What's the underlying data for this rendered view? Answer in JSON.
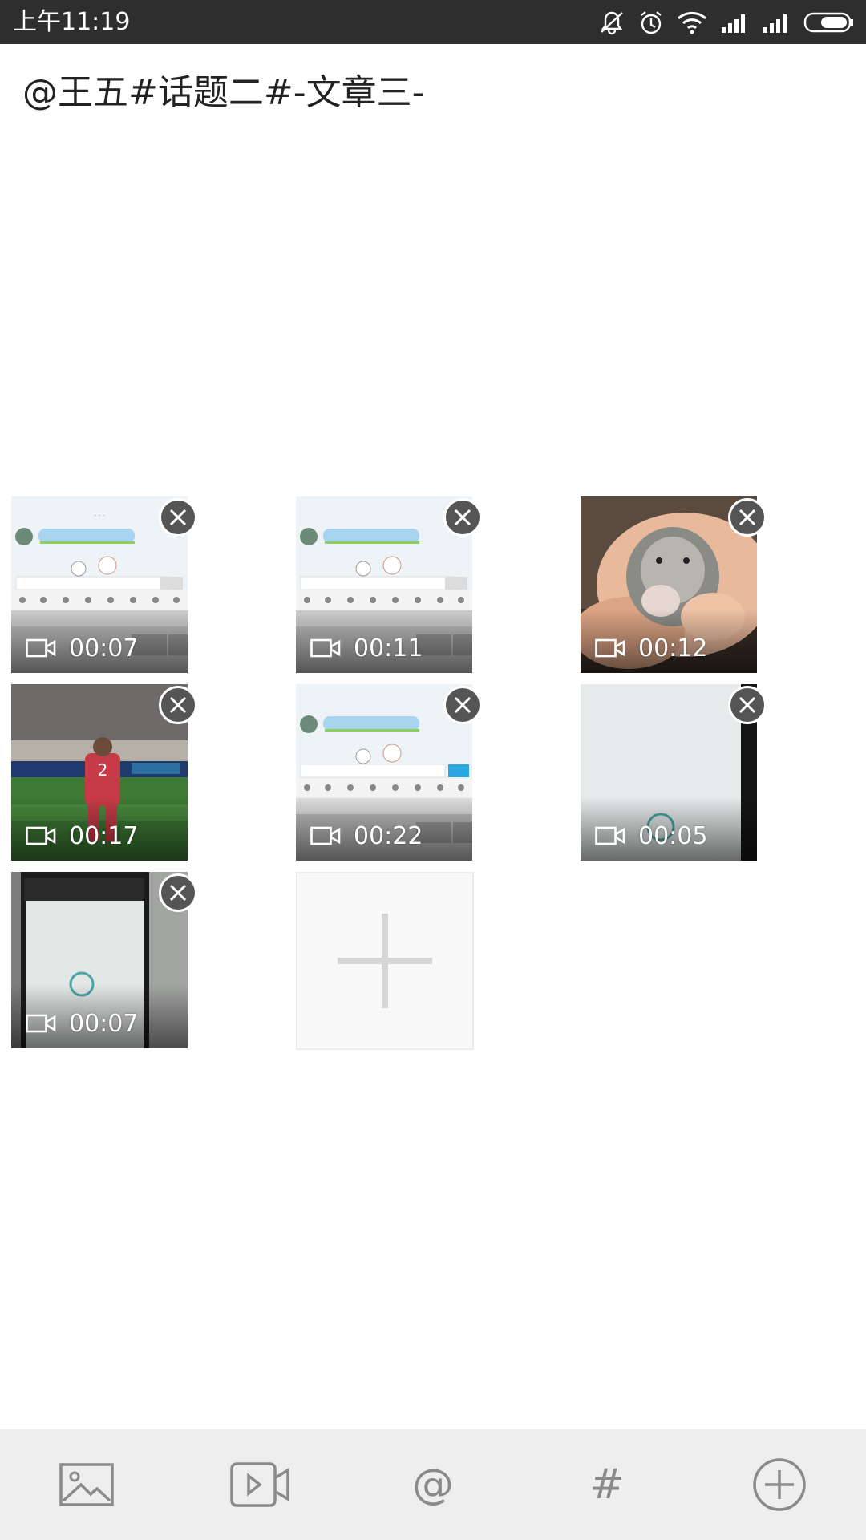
{
  "status_bar": {
    "time": "上午11:19"
  },
  "post": {
    "text": "@王五#话题二#-文章三-"
  },
  "media": [
    {
      "duration": "00:07",
      "thumb": "chat-screenshot"
    },
    {
      "duration": "00:11",
      "thumb": "chat-screenshot"
    },
    {
      "duration": "00:12",
      "thumb": "hamster-in-hand"
    },
    {
      "duration": "00:17",
      "thumb": "soccer-player"
    },
    {
      "duration": "00:22",
      "thumb": "chat-screenshot"
    },
    {
      "duration": "00:05",
      "thumb": "monitor-photo"
    },
    {
      "duration": "00:07",
      "thumb": "phone-screen-photo"
    }
  ],
  "add_tile": {
    "icon": "plus-icon"
  },
  "toolbar": {
    "at_label": "@",
    "hash_label": "#",
    "icons": [
      "image-icon",
      "video-icon",
      "at-icon",
      "hashtag-icon",
      "add-circle-icon"
    ]
  },
  "colors": {
    "status_bar_bg": "#2e2e2e",
    "toolbar_bg": "#eeeeee",
    "icon_gray": "#8a8a8a",
    "remove_bg": "#555555"
  }
}
